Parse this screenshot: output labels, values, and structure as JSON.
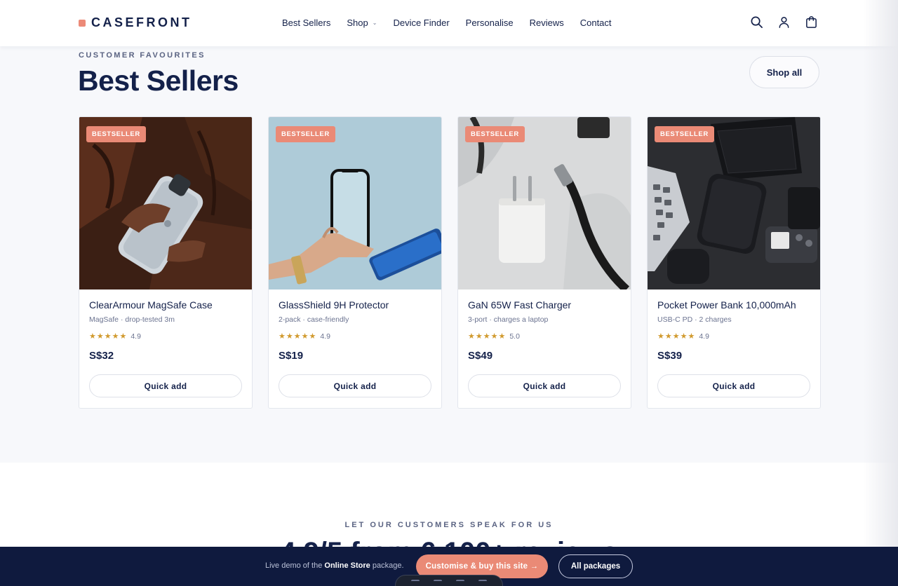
{
  "brand": {
    "name": "CASEFRONT",
    "accent": "#ea8a76",
    "navy": "#14214a"
  },
  "nav": [
    {
      "label": "Best Sellers",
      "has_dropdown": false
    },
    {
      "label": "Shop",
      "has_dropdown": true
    },
    {
      "label": "Device Finder",
      "has_dropdown": false
    },
    {
      "label": "Personalise",
      "has_dropdown": false
    },
    {
      "label": "Reviews",
      "has_dropdown": false
    },
    {
      "label": "Contact",
      "has_dropdown": false
    }
  ],
  "header_icons": [
    "search-icon",
    "account-icon",
    "cart-icon"
  ],
  "best_sellers": {
    "eyebrow": "CUSTOMER FAVOURITES",
    "title": "Best Sellers",
    "shop_all": "Shop all",
    "products": [
      {
        "badge": "BESTSELLER",
        "name": "ClearArmour MagSafe Case",
        "subtitle": "MagSafe · drop-tested 3m",
        "stars": "★★★★★",
        "rating": "4.9",
        "price": "S$32",
        "cta": "Quick add",
        "image": "phone-case-photo"
      },
      {
        "badge": "BESTSELLER",
        "name": "GlassShield 9H Protector",
        "subtitle": "2-pack · case-friendly",
        "stars": "★★★★★",
        "rating": "4.9",
        "price": "S$19",
        "cta": "Quick add",
        "image": "screen-protector-photo"
      },
      {
        "badge": "BESTSELLER",
        "name": "GaN 65W Fast Charger",
        "subtitle": "3-port · charges a laptop",
        "stars": "★★★★★",
        "rating": "5.0",
        "price": "S$49",
        "cta": "Quick add",
        "image": "charger-photo"
      },
      {
        "badge": "BESTSELLER",
        "name": "Pocket Power Bank 10,000mAh",
        "subtitle": "USB-C PD · 2 charges",
        "stars": "★★★★★",
        "rating": "4.9",
        "price": "S$39",
        "cta": "Quick add",
        "image": "power-bank-photo"
      }
    ]
  },
  "testimonials": {
    "eyebrow": "LET OUR CUSTOMERS SPEAK FOR US",
    "heading_partial": "4.9/5 from 6,100+ reviews"
  },
  "bottom_bar": {
    "text_prefix": "Live demo of the ",
    "text_bold": "Online Store",
    "text_suffix": " package.",
    "primary_cta": "Customise & buy this site →",
    "secondary_cta": "All packages"
  }
}
